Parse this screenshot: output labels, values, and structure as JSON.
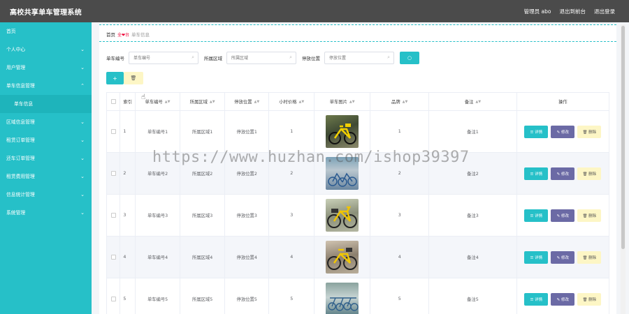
{
  "header": {
    "title": "高校共享单车管理系统",
    "admin_label": "管理员 abo",
    "back_label": "退出到前台",
    "logout_label": "退出登录"
  },
  "sidebar": {
    "items": [
      {
        "label": "首页",
        "has_chevron": false
      },
      {
        "label": "个人中心",
        "has_chevron": true
      },
      {
        "label": "用户管理",
        "has_chevron": true
      },
      {
        "label": "单车信息管理",
        "has_chevron": true,
        "expanded": true
      },
      {
        "label": "单车信息",
        "is_sub": true
      },
      {
        "label": "区域信息管理",
        "has_chevron": true
      },
      {
        "label": "租赁订单管理",
        "has_chevron": true
      },
      {
        "label": "还车订单管理",
        "has_chevron": true
      },
      {
        "label": "租赁费用管理",
        "has_chevron": true
      },
      {
        "label": "信息统计管理",
        "has_chevron": true
      },
      {
        "label": "系统管理",
        "has_chevron": true
      }
    ]
  },
  "breadcrumb": {
    "home": "首页",
    "separator": "全❤台",
    "current": "单车信息"
  },
  "search": {
    "no_label": "单车编号",
    "no_placeholder": "单车编号",
    "area_label": "所属区域",
    "area_placeholder": "所属区域",
    "loc_label": "停放位置",
    "loc_placeholder": "停放位置",
    "button_icon": "○"
  },
  "actions": {
    "add_icon": "+",
    "delete_icon": "🗑"
  },
  "table": {
    "columns": [
      "索引",
      "单车编号",
      "所属区域",
      "停放位置",
      "小时价格",
      "单车图片",
      "品牌",
      "备注",
      "操作"
    ],
    "rows": [
      {
        "idx": "1",
        "no": "单车编号1",
        "area": "所属区域1",
        "loc": "停放位置1",
        "price": "1",
        "brand": "1",
        "note": "备注1"
      },
      {
        "idx": "2",
        "no": "单车编号2",
        "area": "所属区域2",
        "loc": "停放位置2",
        "price": "2",
        "brand": "2",
        "note": "备注2"
      },
      {
        "idx": "3",
        "no": "单车编号3",
        "area": "所属区域3",
        "loc": "停放位置3",
        "price": "3",
        "brand": "3",
        "note": "备注3"
      },
      {
        "idx": "4",
        "no": "单车编号4",
        "area": "所属区域4",
        "loc": "停放位置4",
        "price": "4",
        "brand": "4",
        "note": "备注4"
      },
      {
        "idx": "5",
        "no": "单车编号5",
        "area": "所属区域5",
        "loc": "停放位置5",
        "price": "5",
        "brand": "5",
        "note": "备注5"
      }
    ],
    "op_detail": "☰ 详情",
    "op_edit": "✎ 修改",
    "op_delete": "🗑 删除"
  },
  "watermark": "https://www.huzhan.com/ishop39397",
  "colors": {
    "topbar": "#4b4b4b",
    "sidebar": "#26c0c8",
    "accent": "#26c0c8",
    "edit_button": "#6b6aa5",
    "delete_button": "#fdf6c5"
  }
}
